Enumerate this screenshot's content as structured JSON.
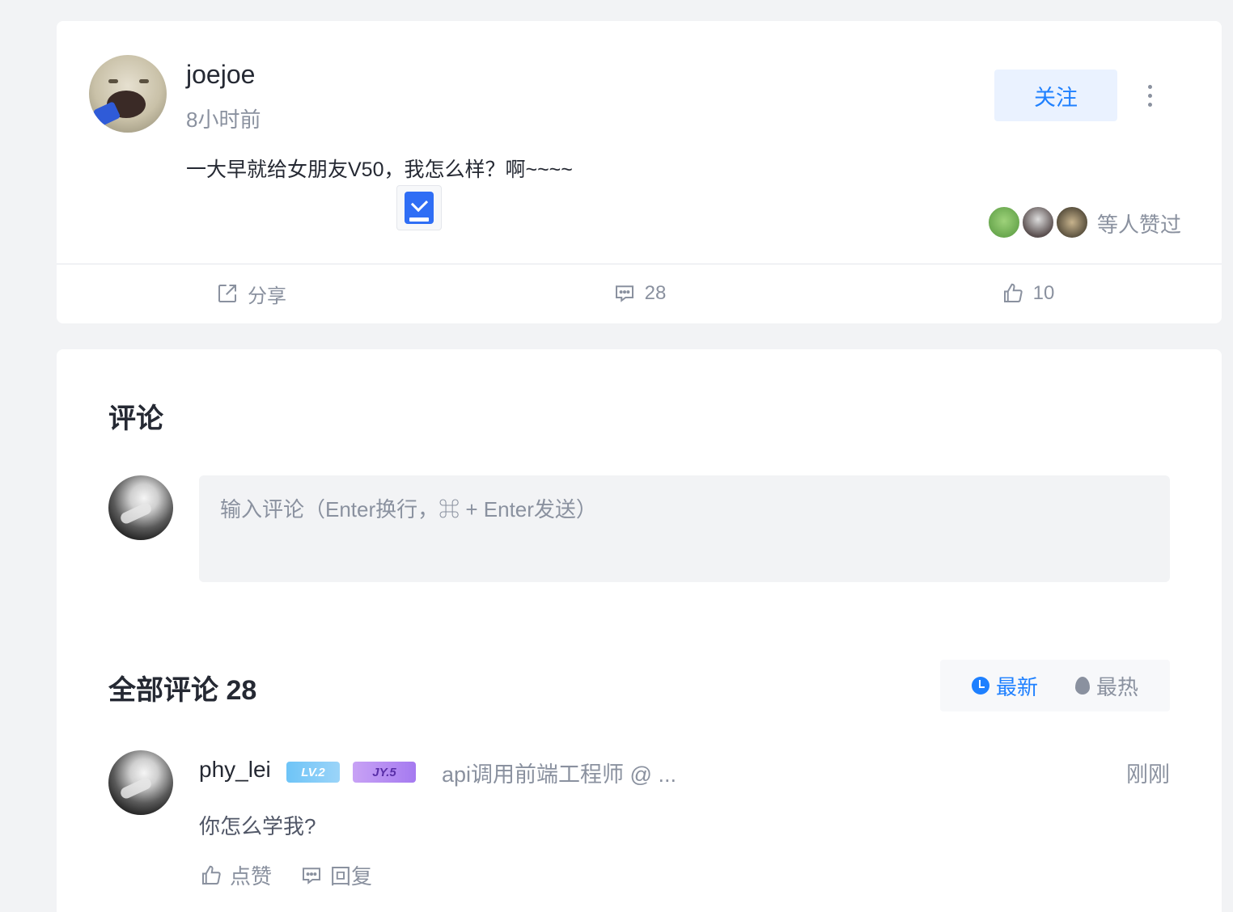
{
  "post": {
    "username": "joejoe",
    "time": "8小时前",
    "content": "一大早就给女朋友V50，我怎么样？啊~~~~",
    "follow_label": "关注",
    "likers_text": "等人赞过",
    "actions": {
      "share_label": "分享",
      "comment_count": "28",
      "like_count": "10"
    }
  },
  "comments": {
    "title": "评论",
    "input_placeholder": "输入评论（Enter换行，⌘ + Enter发送）",
    "all_title": "全部评论 28",
    "sort": {
      "newest": "最新",
      "hottest": "最热"
    },
    "items": [
      {
        "user": "phy_lei",
        "level_badge": "LV.2",
        "jy_badge": "JY.5",
        "job_title": "api调用前端工程师 @ ...",
        "time": "刚刚",
        "text": "你怎么学我?",
        "like_label": "点赞",
        "reply_label": "回复"
      }
    ]
  },
  "colors": {
    "accent": "#1e80ff",
    "muted": "#8a919f",
    "page_bg": "#f2f3f5"
  }
}
